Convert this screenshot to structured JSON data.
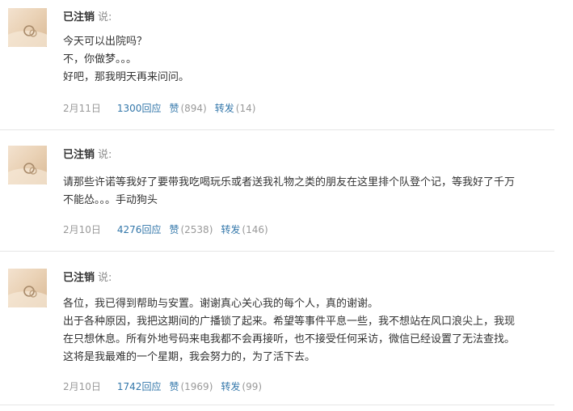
{
  "posts": [
    {
      "author": "已注销",
      "say_label": "说:",
      "lines": [
        "今天可以出院吗？",
        "不，你做梦。。。",
        "好吧，那我明天再来问问。"
      ],
      "date": "2月11日",
      "replies": "1300回应",
      "like_label": "赞",
      "like_count": "(894)",
      "share_label": "转发",
      "share_count": "(14)"
    },
    {
      "author": "已注销",
      "say_label": "说:",
      "lines": [
        "请那些许诺等我好了要带我吃喝玩乐或者送我礼物之类的朋友在这里排个队登个记，等我好了千万",
        "不能怂。。。手动狗头"
      ],
      "date": "2月10日",
      "replies": "4276回应",
      "like_label": "赞",
      "like_count": "(2538)",
      "share_label": "转发",
      "share_count": "(146)"
    },
    {
      "author": "已注销",
      "say_label": "说:",
      "lines": [
        "各位，我已得到帮助与安置。谢谢真心关心我的每个人，真的谢谢。",
        "出于各种原因，我把这期间的广播锁了起来。希望等事件平息一些，我不想站在风口浪尖上，我现",
        "在只想休息。所有外地号码来电我都不会再接听，也不接受任何采访，微信已经设置了无法查找。",
        "这将是我最难的一个星期，我会努力的，为了活下去。"
      ],
      "date": "2月10日",
      "replies": "1742回应",
      "like_label": "赞",
      "like_count": "(1969)",
      "share_label": "转发",
      "share_count": "(99)"
    }
  ]
}
